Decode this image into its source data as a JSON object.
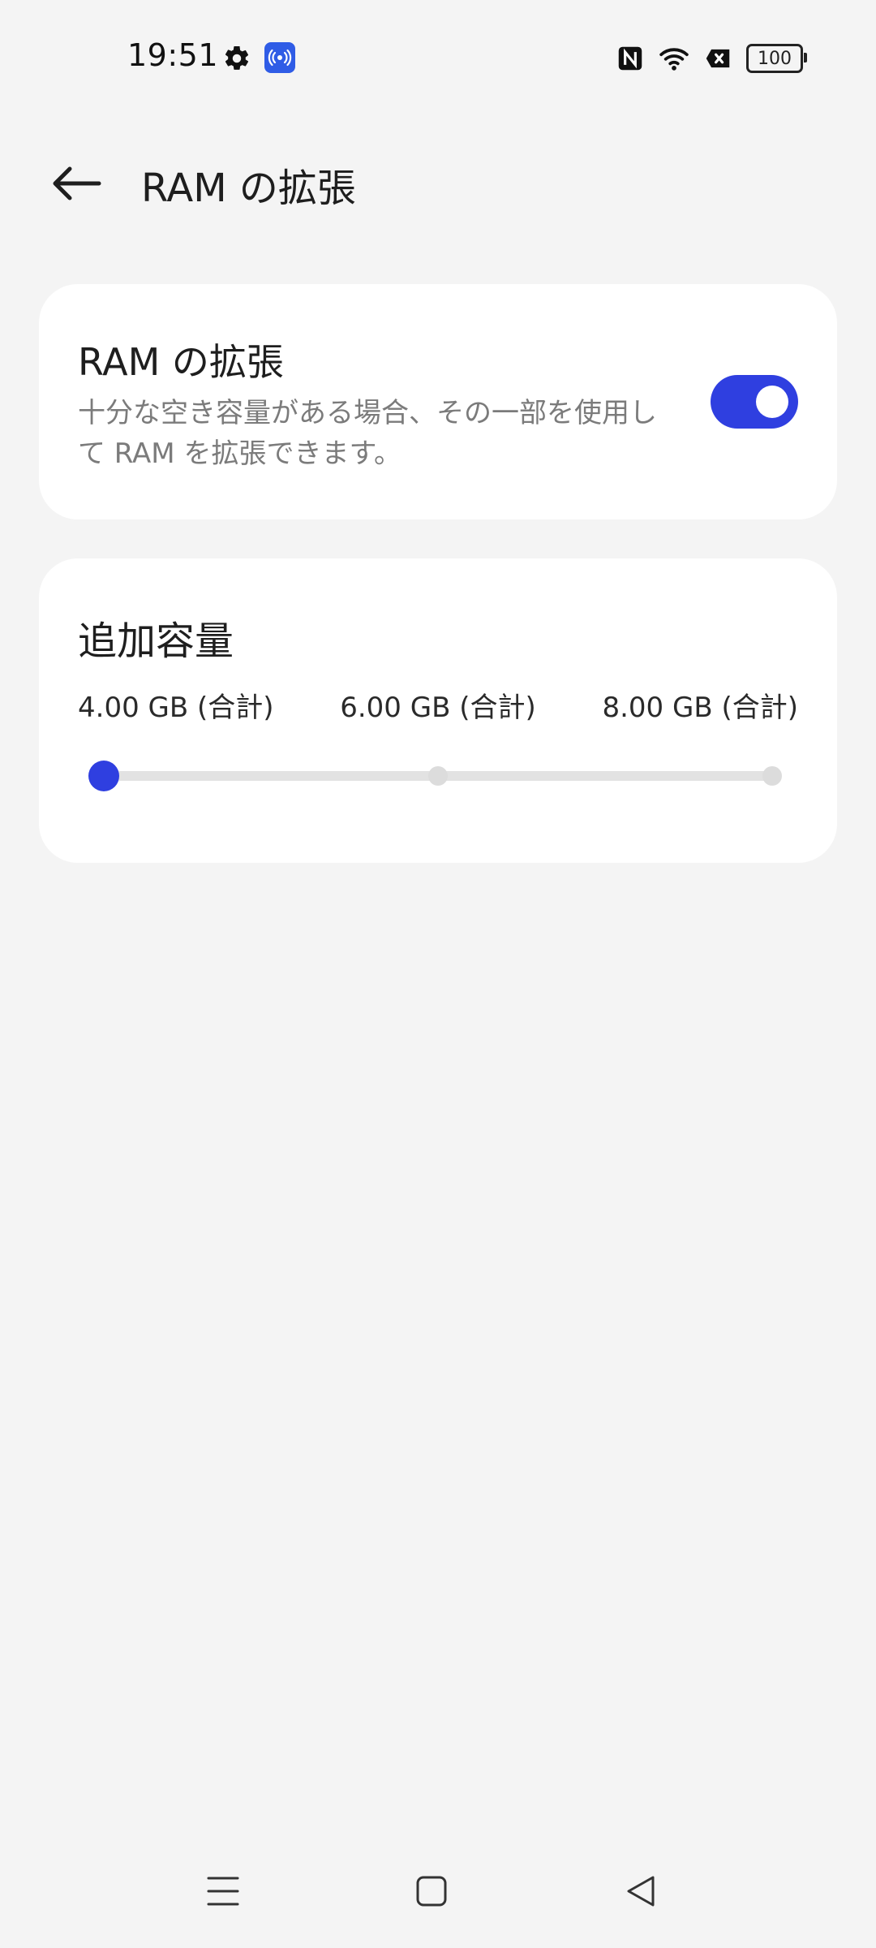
{
  "status_bar": {
    "time": "19:51",
    "battery": "100"
  },
  "header": {
    "title": "RAM の拡張"
  },
  "toggle_card": {
    "title": "RAM の拡張",
    "description": "十分な空き容量がある場合、その一部を使用して RAM を拡張できます。",
    "enabled": true
  },
  "capacity_card": {
    "title": "追加容量",
    "options": [
      "4.00 GB (合計)",
      "6.00 GB (合計)",
      "8.00 GB (合計)"
    ],
    "selected_index": 0
  },
  "colors": {
    "accent": "#2f3fe0",
    "background": "#f4f4f4",
    "card": "#ffffff",
    "secondary_text": "#7b7b7b"
  },
  "icons": {
    "back": "arrow-left-icon",
    "status": [
      "gear-icon",
      "hotspot-icon",
      "nfc-icon",
      "wifi-icon",
      "no-sim-icon",
      "battery-icon"
    ],
    "nav": [
      "menu-icon",
      "home-icon",
      "back-triangle-icon"
    ]
  }
}
